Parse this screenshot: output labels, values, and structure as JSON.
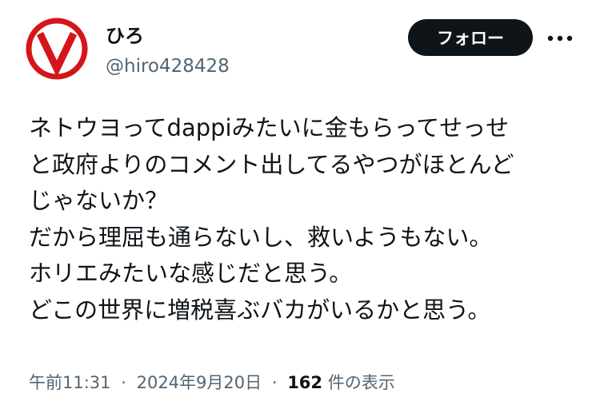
{
  "user": {
    "display_name": "ひろ",
    "handle": "@hiro428428",
    "avatar_icon": "v-logo-avatar",
    "avatar_color": "#d4151b"
  },
  "actions": {
    "follow_label": "フォロー",
    "more_icon": "more-dots-icon"
  },
  "tweet": {
    "lines": [
      "ネトウヨってdappiみたいに金もらってせっせ",
      "と政府よりのコメント出してるやつがほとんど",
      "じゃないか？",
      "だから理屈も通らないし、救いようもない。",
      "ホリエみたいな感じだと思う。",
      "どこの世界に増税喜ぶバカがいるかと思う。"
    ]
  },
  "meta": {
    "time": "午前11:31",
    "separator": "·",
    "date": "2024年9月20日",
    "view_count": "162",
    "views_label": "件の表示"
  },
  "colors": {
    "text": "#0f1419",
    "secondary": "#536471",
    "button_bg": "#0f1419",
    "button_text": "#ffffff"
  }
}
